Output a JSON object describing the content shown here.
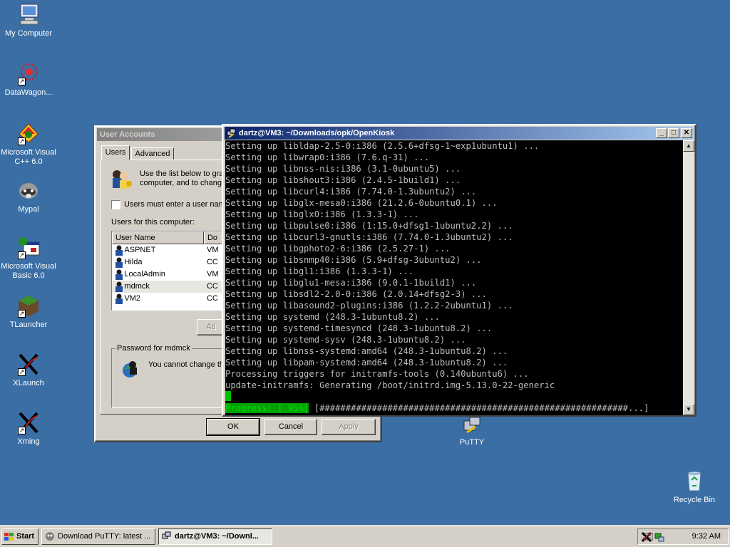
{
  "desktop": {
    "icons": [
      {
        "label": "My Computer",
        "icon": "computer-icon"
      },
      {
        "label": "DataWagon...",
        "icon": "datawagon-icon"
      },
      {
        "label": "Microsoft Visual C++ 6.0",
        "icon": "visual-cpp-icon"
      },
      {
        "label": "Mypal",
        "icon": "mypal-icon"
      },
      {
        "label": "Microsoft Visual Basic 6.0",
        "icon": "visual-basic-icon"
      },
      {
        "label": "TLauncher",
        "icon": "tlauncher-icon"
      },
      {
        "label": "XLaunch",
        "icon": "xlaunch-icon"
      },
      {
        "label": "Xming",
        "icon": "xming-icon"
      },
      {
        "label": "PuTTY",
        "icon": "putty-icon"
      },
      {
        "label": "Recycle Bin",
        "icon": "recycle-bin-icon"
      }
    ]
  },
  "user_accounts": {
    "title": "User Accounts",
    "tabs": [
      "Users",
      "Advanced"
    ],
    "intro_text_line1": "Use the list below to gra",
    "intro_text_line2": "computer, and to chang",
    "checkbox_label": "Users must enter a user nam",
    "users_label": "Users for this computer:",
    "columns": [
      "User Name",
      "Do"
    ],
    "users": [
      {
        "name": "ASPNET",
        "domain": "VM"
      },
      {
        "name": "Hilda",
        "domain": "CC"
      },
      {
        "name": "LocalAdmin",
        "domain": "VM"
      },
      {
        "name": "mdmck",
        "domain": "CC"
      },
      {
        "name": "VM2",
        "domain": "CC"
      }
    ],
    "add_button": "Ad",
    "password_group": "Password for mdmck",
    "password_text": "You cannot change th",
    "ok": "OK",
    "cancel": "Cancel",
    "apply": "Apply"
  },
  "terminal": {
    "title": "dartz@VM3: ~/Downloads/opk/OpenKiosk",
    "lines": [
      "Setting up libldap-2.5-0:i386 (2.5.6+dfsg-1~exp1ubuntu1) ...",
      "Setting up libwrap0:i386 (7.6.q-31) ...",
      "Setting up libnss-nis:i386 (3.1-0ubuntu5) ...",
      "Setting up libshout3:i386 (2.4.5-1build1) ...",
      "Setting up libcurl4:i386 (7.74.0-1.3ubuntu2) ...",
      "Setting up libglx-mesa0:i386 (21.2.6-0ubuntu0.1) ...",
      "Setting up libglx0:i386 (1.3.3-1) ...",
      "Setting up libpulse0:i386 (1:15.0+dfsg1-1ubuntu2.2) ...",
      "Setting up libcurl3-gnutls:i386 (7.74.0-1.3ubuntu2) ...",
      "Setting up libgphoto2-6:i386 (2.5.27-1) ...",
      "Setting up libsnmp40:i386 (5.9+dfsg-3ubuntu2) ...",
      "Setting up libgl1:i386 (1.3.3-1) ...",
      "Setting up libglu1-mesa:i386 (9.0.1-1build1) ...",
      "Setting up libsdl2-2.0-0:i386 (2.0.14+dfsg2-3) ...",
      "Setting up libasound2-plugins:i386 (1.2.2-2ubuntu1) ...",
      "Setting up systemd (248.3-1ubuntu8.2) ...",
      "Setting up systemd-timesyncd (248.3-1ubuntu8.2) ...",
      "Setting up systemd-sysv (248.3-1ubuntu8.2) ...",
      "Setting up libnss-systemd:amd64 (248.3-1ubuntu8.2) ...",
      "Setting up libpam-systemd:amd64 (248.3-1ubuntu8.2) ...",
      "Processing triggers for initramfs-tools (0.140ubuntu6) ...",
      "update-initramfs: Generating /boot/initrd.img-5.13.0-22-generic"
    ],
    "progress_label": "Progress: [ 95%]",
    "progress_bar": "[###########################################################...]",
    "progress_percent": 95
  },
  "taskbar": {
    "start": "Start",
    "tasks": [
      "Download PuTTY: latest ...",
      "dartz@VM3: ~/Downl..."
    ],
    "clock": "9:32 AM"
  }
}
